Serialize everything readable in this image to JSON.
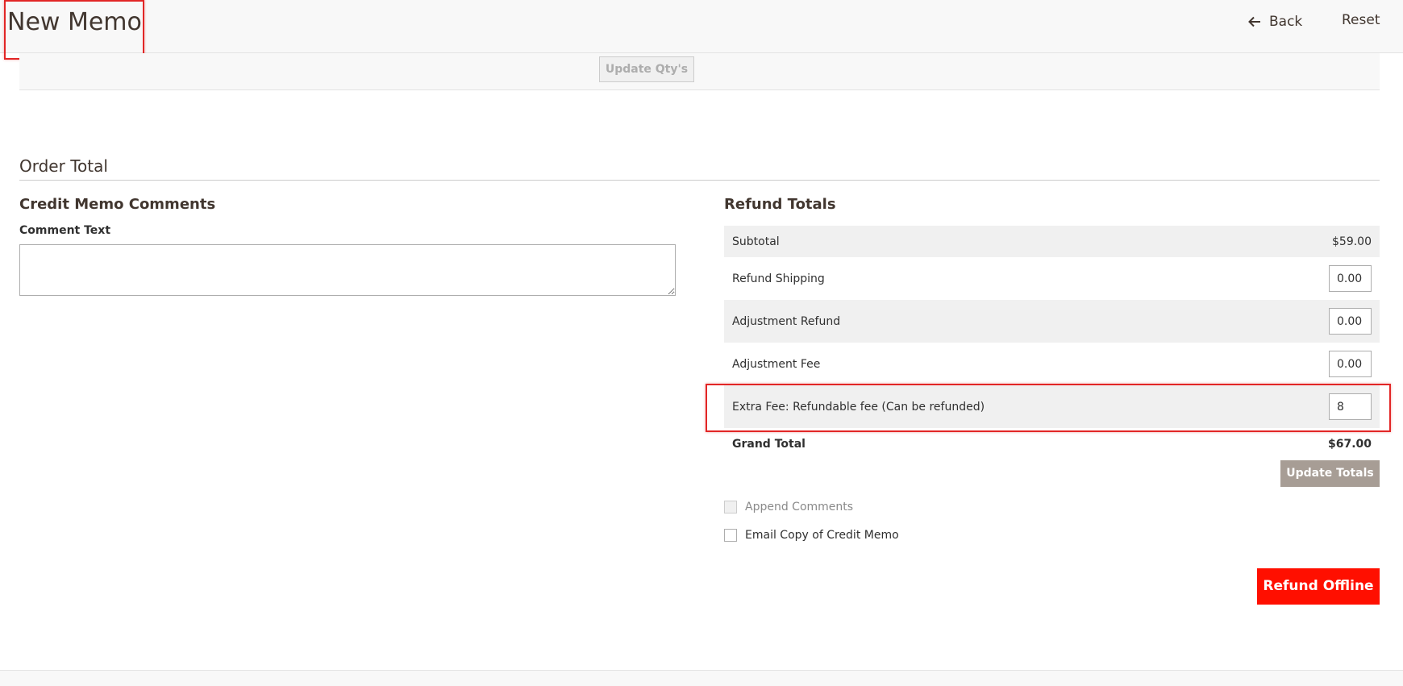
{
  "header": {
    "title": "New Memo",
    "back_label": "Back",
    "reset_label": "Reset"
  },
  "items": {
    "update_qty_label": "Update Qty's"
  },
  "order_total": {
    "section_title": "Order Total",
    "comments": {
      "heading": "Credit Memo Comments",
      "comment_label": "Comment Text",
      "comment_value": ""
    },
    "refund_totals": {
      "heading": "Refund Totals",
      "subtotal_label": "Subtotal",
      "subtotal_value": "$59.00",
      "refund_shipping_label": "Refund Shipping",
      "refund_shipping_value": "0.00",
      "adjustment_refund_label": "Adjustment Refund",
      "adjustment_refund_value": "0.00",
      "adjustment_fee_label": "Adjustment Fee",
      "adjustment_fee_value": "0.00",
      "extra_fee_label": "Extra Fee: Refundable fee (Can be refunded)",
      "extra_fee_value": "8",
      "grand_total_label": "Grand Total",
      "grand_total_value": "$67.00",
      "update_totals_label": "Update Totals",
      "append_comments_label": "Append Comments",
      "email_copy_label": "Email Copy of Credit Memo",
      "refund_offline_label": "Refund Offline"
    }
  },
  "colors": {
    "refund_button": "#ff0f00",
    "highlight": "#e22626",
    "update_totals_button": "#a79d95"
  }
}
